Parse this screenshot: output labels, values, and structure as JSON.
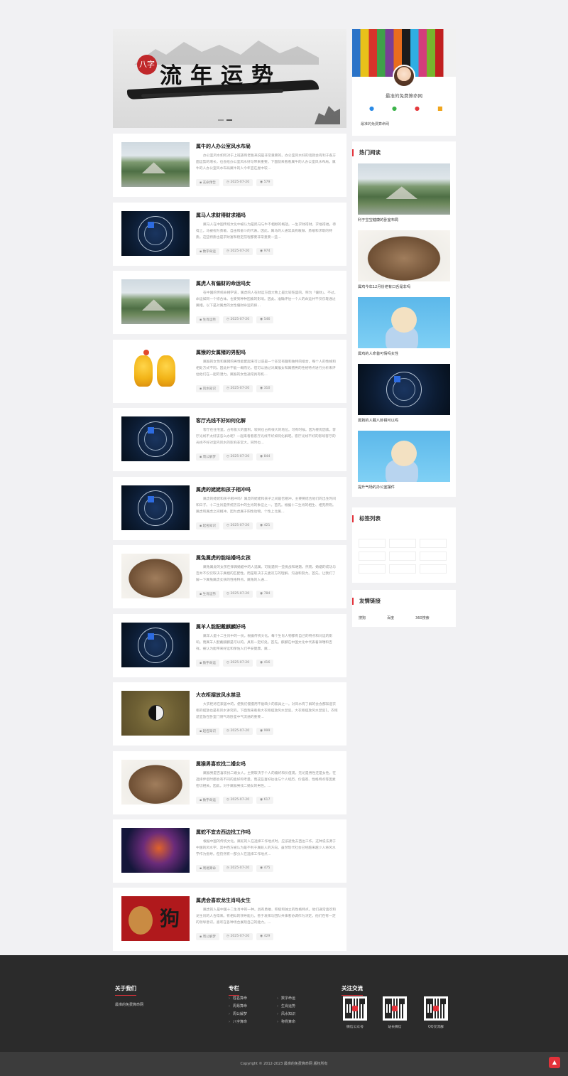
{
  "banner": {
    "seal": "八字",
    "title": "流年运势"
  },
  "articles": [
    {
      "title": "属牛的人办公室风水布局",
      "desc": "办公室风水如何对于上班族和老板来说是非常重要的。办公室风水好的话就会有利于各方面运势的增长，也会给办公室风水好与带来重要。下面就来看看属牛的人办公室风水布局。属牛的人办公室风水布局属牛的人今年宜在屋中较…",
      "tag": "玄命预告",
      "date": "2025-07-20",
      "views": "579"
    },
    {
      "title": "属马人求财得财求福吗",
      "desc": "属马人在中国传统文化中被认为是民马与牛不相顾的概括。一生求财得财。求福得福。待得上。马被视为勇敢、自由和奋斗的代表。因此，属马的人通常具有敢做、勇敢和求取的特质。这些特质也是求财富和稳定前程都要非常重要一些…",
      "tag": "数字命运",
      "date": "2025-07-20",
      "views": "974"
    },
    {
      "title": "属虎人有偏财的命运吗女",
      "desc": "在中国的传统命相学说，属虎的人在财运方面大致上是比较旺盛的。称为「偏财」，不过。命运如同一个综合体。也受到种种因素的影响。因此。准确评估一个人的命运并不仅仅靠通过属相。以下是对属虎的女性偏财命运的探…",
      "tag": "生肖运势",
      "date": "2025-07-20",
      "views": "546"
    },
    {
      "title": "属猴的女属猪的男配吗",
      "desc": "属猴的女性和属猪的男性能配起来可以说是一个非常有趣和独特的组合。每个人的性格和相处方式不同。因此并不能一概而论。但可以通过对属猴女和属猪男的性格特点进行分析来评估他们在一起的潜力。属猴的女性通常具有机…",
      "tag": "风水知识",
      "date": "2025-07-20",
      "views": "310"
    },
    {
      "title": "客厅光线不好如何化解",
      "desc": "客厅在住宅里。占有极大的面积。较同也占有很大的地位。可有时候。因为楼房因素。客厅光线不太好该怎么办呢？一起来看看客厅光线不好如何化解吧。客厅光线不好的影响客厅的光线不好对室内风水的影响非常大。同时也…",
      "tag": "周公解梦",
      "date": "2025-07-20",
      "views": "844"
    },
    {
      "title": "属虎的姥姥和孩子相冲吗",
      "desc": "属虎的姥姥和孩子相冲吗？属虎的姥姥和孩子之间是否相冲。主要要结合他们的出生时间和日子。十二生肖是传统历法中的生肖的象征之一。首先。根据十二生肖的相生、相克原则。属虎和属虎之间相冲。因为虎属于阳性动物。个性上比属…",
      "tag": "起名知识",
      "date": "2025-07-20",
      "views": "421"
    },
    {
      "title": "属兔属虎的能结婚吗女孩",
      "desc": "属兔属虎的女孩在择偶婚姻中的人选属。可能遇到一些挑战和难题。然而，婚姻的成功与否并不仅仅取决于属相的匹配性。而是取决于夫妻双方的理解、沟通和努力。首先，让我们了解一下属兔属虎女孩的性格特点。属兔的人通…",
      "tag": "生肖运势",
      "date": "2025-07-20",
      "views": "784"
    },
    {
      "title": "属羊人能配戴麒麟好吗",
      "desc": "属羊人是十二生肖中的一员。根据传统文化。每个生肖人物都有自己的特点和对运的影响。而属羊人配戴麒麟是可以的。具有一定好处。首先。麒麟在中国文化中代表着祥瑞和吉祥。被认为能带来好运和保佑人们平安健康。属…",
      "tag": "数字命运",
      "date": "2025-07-20",
      "views": "416"
    },
    {
      "title": "大衣柜摆放风水禁忌",
      "desc": "大衣柜将在家居中的，使我们慢慢用不能缺少的家具之一。对风水有了解的会会都知道衣柜的摆放也是有风水讲究的。下面我来看看大衣柜摆放风水禁忌。大衣柜摆放风水禁忌1。衣柜适宜放在卧室门侧气场卧室中气流通的重要…",
      "tag": "起名知识",
      "date": "2025-07-20",
      "views": "999"
    },
    {
      "title": "属猴男喜欢找二婚女吗",
      "desc": "属猴男是否喜欢找二婚女人。主要取决于个人的偏好和价值观。无论是男性还是女性。在选择伴侣时都会有不同的喜好和考量。而这些喜好往往与个人经历、价值观、性格特点等因素密切相关。因此。对于属猴男找二婚女的男性。…",
      "tag": "数字命运",
      "date": "2025-07-20",
      "views": "617"
    },
    {
      "title": "属蛇不宜去西边找工作吗",
      "desc": "根据中国的传统文化。属蛇的人在选择工作地点时。应该避免去西边工作。这种说法源于中国的风水学。其中西方被认为是不利于属蛇人的方向。虽然现代社会已经越来越少人将风水学作为指导。但仍然有一部分人在选择工作地点…",
      "tag": "周易算命",
      "date": "2025-07-20",
      "views": "475"
    },
    {
      "title": "属虎会喜欢龙生肖吗女生",
      "desc": "属虎的人是中国十二生肖中的一种。具有勇敢、积极和独立的性格特点。他们通常喜欢和龙生肖的人合得来。有相似的领导能力。善于发挥与团队共事者协调作为决定。他们在有一定的领导意识。喜欢在各种场合展现自己的能力。…",
      "tag": "周公解梦",
      "date": "2025-07-20",
      "views": "429"
    }
  ],
  "profile": {
    "name": "最准的免费算命网",
    "desc": "最准的免费算命网"
  },
  "hot": {
    "title": "热门阅读",
    "items": [
      {
        "caption": "利于宝宝健康的卧室布局"
      },
      {
        "caption": "属鸡今年12月份老有口舌是非吗"
      },
      {
        "caption": "属鸡的人命首可情吗女性"
      },
      {
        "caption": "属狗的人戴八卦镜可以吗"
      },
      {
        "caption": "提升气场的办公室摆件"
      }
    ]
  },
  "tags": {
    "title": "标签列表"
  },
  "links": {
    "title": "友情链接",
    "items": [
      "搜狗",
      "百度",
      "360搜索"
    ]
  },
  "footer": {
    "about_title": "关于我们",
    "about_text": "最准的免费算命网",
    "column_title": "专栏",
    "menu": [
      "姓名算命",
      "数字命运",
      "周易算命",
      "生肖运势",
      "周公解梦",
      "风水知识",
      "八字算命",
      "称骨算命"
    ],
    "follow_title": "关注交流",
    "qr": [
      "微信公众号",
      "站长微信",
      "QQ交流群"
    ],
    "copyright": "Copyright © 2012-2023 最准的免费算命网 版权所有"
  }
}
